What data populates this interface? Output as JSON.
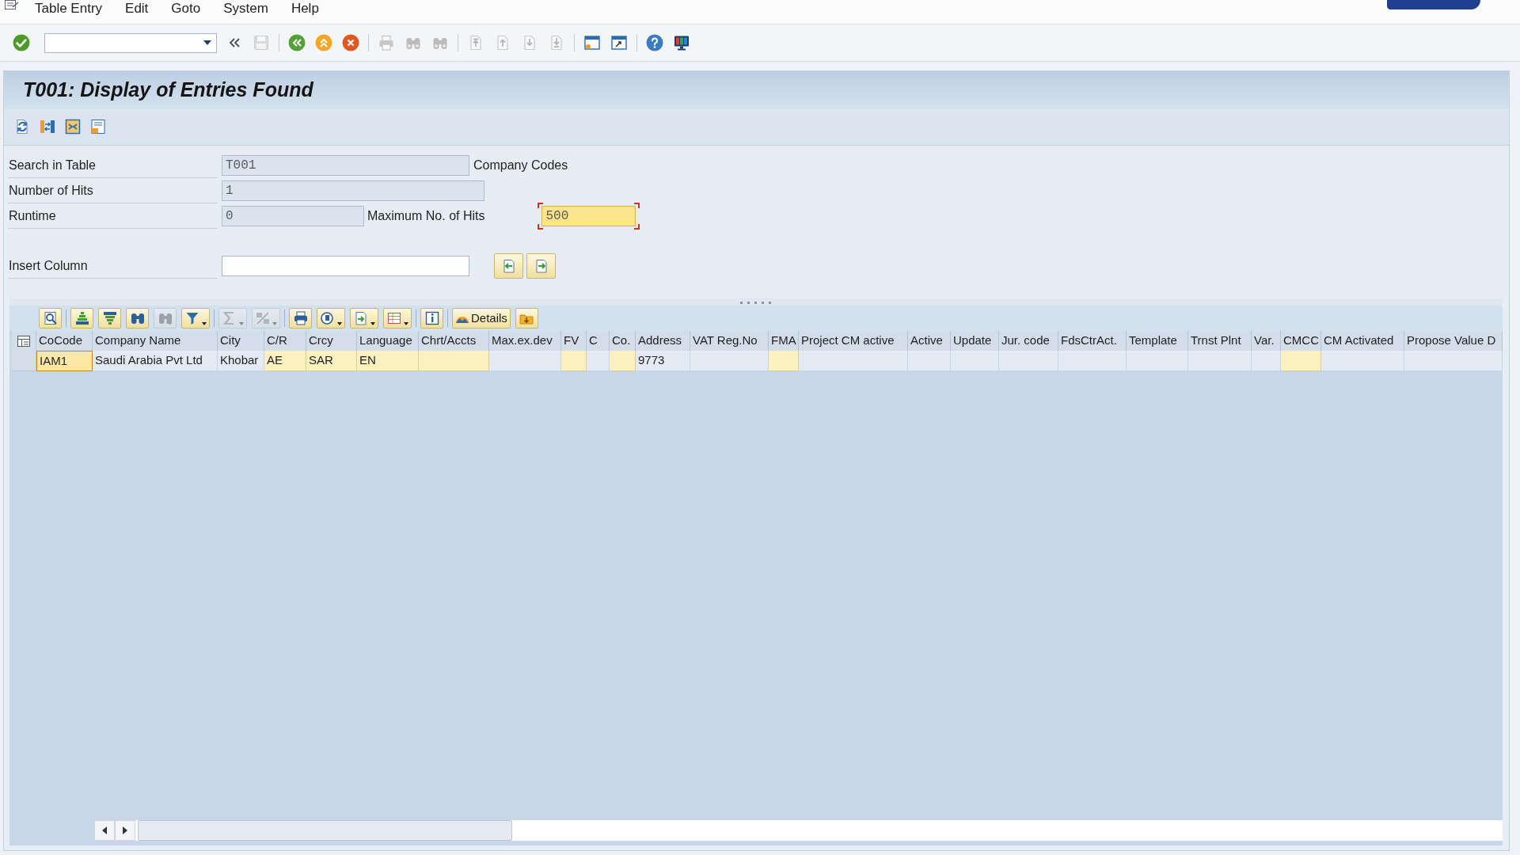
{
  "menu_bar": {
    "items": [
      {
        "label": "Table Entry"
      },
      {
        "label": "Edit"
      },
      {
        "label": "Goto"
      },
      {
        "label": "System"
      },
      {
        "label": "Help"
      }
    ]
  },
  "standard_toolbar": {
    "buttons": [
      {
        "disabled": false
      },
      {
        "disabled": false
      },
      {
        "disabled": true
      },
      {
        "disabled": false
      },
      {
        "disabled": false
      },
      {
        "disabled": false
      },
      {
        "disabled": true
      },
      {
        "disabled": true
      },
      {
        "disabled": true
      },
      {
        "disabled": true
      },
      {
        "disabled": true
      },
      {
        "disabled": true
      },
      {
        "disabled": true
      },
      {
        "disabled": false
      },
      {
        "disabled": false
      },
      {
        "disabled": false
      },
      {
        "disabled": false
      }
    ]
  },
  "title": "T001: Display of Entries Found",
  "selection": {
    "rows": [
      {
        "label": "Search in Table",
        "field": {
          "value": "T001",
          "editable": false,
          "focused": false
        },
        "description": "Company Codes"
      },
      {
        "label": "Number of Hits",
        "field": {
          "value": "1",
          "editable": false,
          "focused": false
        }
      },
      {
        "label": "Runtime",
        "field": {
          "value": "0",
          "editable": false,
          "focused": false
        },
        "limit": {
          "label": "Maximum No. of Hits",
          "field": {
            "value": "500",
            "editable": true,
            "focused": true
          }
        }
      }
    ],
    "insert_column": {
      "label": "Insert Column",
      "field": {
        "editable": true,
        "focused": false
      }
    }
  },
  "grid": {
    "toolbar": {
      "groups": [
        {
          "buttons": [
            {
              "disabled": false,
              "dropdown": false
            }
          ]
        },
        {
          "buttons": [
            {
              "disabled": false,
              "dropdown": false
            },
            {
              "disabled": false,
              "dropdown": false
            },
            {
              "disabled": false,
              "dropdown": false
            },
            {
              "disabled": true,
              "dropdown": false
            },
            {
              "disabled": false,
              "dropdown": true
            }
          ]
        },
        {
          "buttons": [
            {
              "disabled": true,
              "dropdown": true
            },
            {
              "disabled": true,
              "dropdown": true
            }
          ]
        },
        {
          "buttons": [
            {
              "disabled": false,
              "dropdown": false
            },
            {
              "disabled": false,
              "dropdown": true
            },
            {
              "disabled": false,
              "dropdown": true
            },
            {
              "disabled": false,
              "dropdown": true
            }
          ]
        },
        {
          "buttons": [
            {
              "disabled": false,
              "dropdown": false
            }
          ]
        },
        {
          "buttons": [
            {
              "label": "Details",
              "disabled": false,
              "dropdown": false
            },
            {
              "disabled": false,
              "dropdown": false
            }
          ]
        }
      ]
    },
    "columns": [
      {
        "label": "CoCode",
        "highlighted": true
      },
      {
        "label": "Company Name",
        "highlighted": false
      },
      {
        "label": "City",
        "highlighted": false
      },
      {
        "label": "C/R",
        "highlighted": true
      },
      {
        "label": "Crcy",
        "highlighted": true
      },
      {
        "label": "Language",
        "highlighted": true
      },
      {
        "label": "Chrt/Accts",
        "highlighted": true
      },
      {
        "label": "Max.ex.dev",
        "highlighted": false
      },
      {
        "label": "FV",
        "highlighted": true
      },
      {
        "label": "C",
        "highlighted": false
      },
      {
        "label": "Co.",
        "highlighted": true
      },
      {
        "label": "Address",
        "highlighted": false
      },
      {
        "label": "VAT Reg.No",
        "highlighted": false
      },
      {
        "label": "FMA",
        "highlighted": true
      },
      {
        "label": "Project CM active",
        "highlighted": false
      },
      {
        "label": "Active",
        "highlighted": false
      },
      {
        "label": "Update",
        "highlighted": false
      },
      {
        "label": "Jur. code",
        "highlighted": false
      },
      {
        "label": "FdsCtrAct.",
        "highlighted": false
      },
      {
        "label": "Template",
        "highlighted": false
      },
      {
        "label": "Trnst Plnt",
        "highlighted": false
      },
      {
        "label": "Var.",
        "highlighted": false
      },
      {
        "label": "CMCC",
        "highlighted": true
      },
      {
        "label": "CM Activated",
        "highlighted": false
      },
      {
        "label": "Propose Value D",
        "highlighted": false
      }
    ],
    "rows": [
      {
        "selected": false,
        "cells": [
          {
            "text": "IAM1",
            "focused": true
          },
          {
            "text": "Saudi Arabia Pvt Ltd",
            "focused": false
          },
          {
            "text": "Khobar",
            "focused": false
          },
          {
            "text": "AE",
            "focused": false
          },
          {
            "text": "SAR",
            "focused": false
          },
          {
            "text": "EN",
            "focused": false
          },
          {
            "focused": false
          },
          {
            "focused": false
          },
          {
            "focused": false
          },
          {
            "focused": false
          },
          {
            "focused": false
          },
          {
            "text": "9773",
            "focused": false
          },
          {
            "focused": false
          },
          {
            "focused": false
          },
          {
            "focused": false
          },
          {
            "focused": false
          },
          {
            "focused": false
          },
          {
            "focused": false
          },
          {
            "focused": false
          },
          {
            "focused": false
          },
          {
            "focused": false
          },
          {
            "focused": false
          },
          {
            "focused": false
          },
          {
            "focused": false
          },
          {
            "focused": false
          }
        ]
      }
    ]
  }
}
